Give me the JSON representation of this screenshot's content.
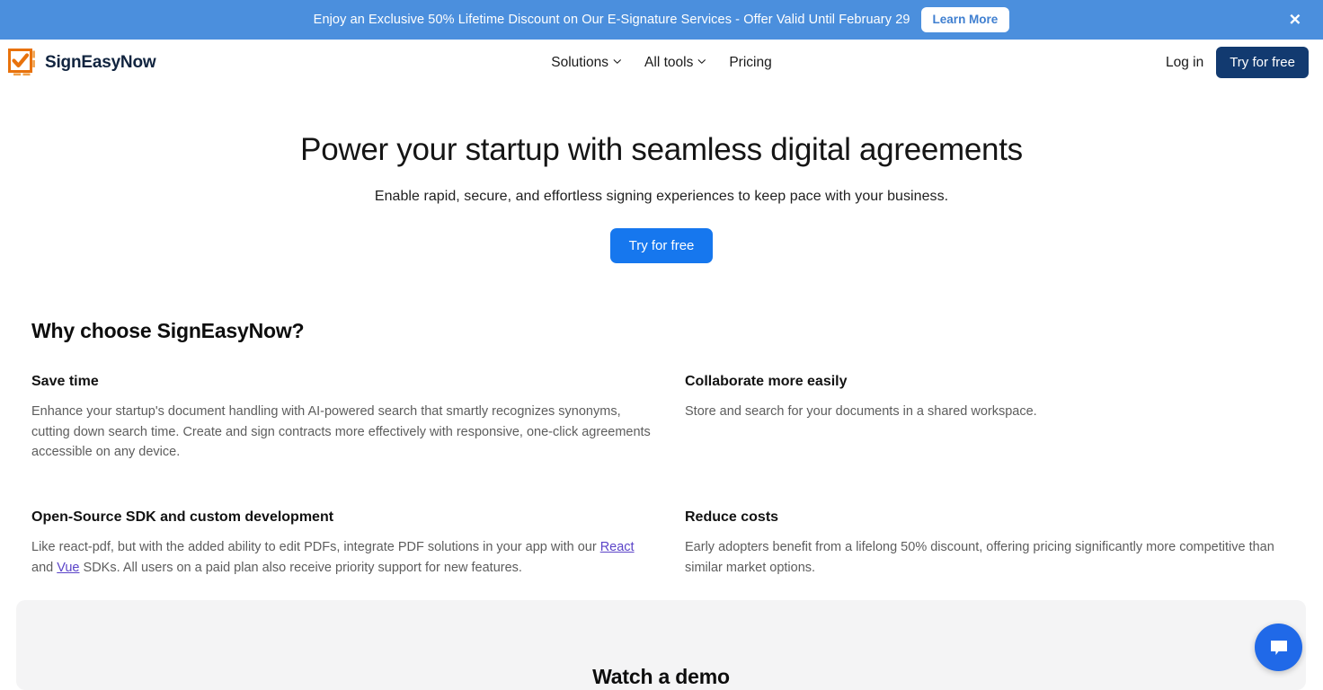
{
  "promo": {
    "text": "Enjoy an Exclusive 50% Lifetime Discount on Our E-Signature Services - Offer Valid Until February 29",
    "learn_more_label": "Learn More",
    "close_label": "✕",
    "background_color": "#4b8fdd"
  },
  "header": {
    "brand_name": "SignEasyNow",
    "logo_icon": "orange-checkbox-icon",
    "logo_color": "#e8720c",
    "nav": [
      {
        "label": "Solutions",
        "has_dropdown": true,
        "icon": "chevron-down-icon"
      },
      {
        "label": "All tools",
        "has_dropdown": true,
        "icon": "chevron-down-icon"
      },
      {
        "label": "Pricing",
        "has_dropdown": false,
        "icon": ""
      }
    ],
    "login_label": "Log in",
    "try_label": "Try for free",
    "try_button_color": "#123a70"
  },
  "hero": {
    "title": "Power your startup with seamless digital agreements",
    "subtitle": "Enable rapid, secure, and effortless signing experiences to keep pace with your business.",
    "cta_label": "Try for free",
    "cta_color": "#1677ee"
  },
  "why": {
    "section_title": "Why choose SignEasyNow?",
    "features": [
      {
        "title": "Save time",
        "body": "Enhance your startup's document handling with AI-powered search that smartly recognizes synonyms, cutting down search time. Create and sign contracts more effectively with responsive, one-click agreements accessible on any device."
      },
      {
        "title": "Collaborate more easily",
        "body": "Store and search for your documents in a shared workspace."
      },
      {
        "title": "Open-Source SDK and custom development",
        "body_part1": "Like react-pdf, but with the added ability to edit PDFs, integrate PDF solutions in your app with our ",
        "link1": "React",
        "body_part2": " and ",
        "link2": "Vue",
        "body_part3": " SDKs. All users on a paid plan also receive priority support for new features.",
        "link_color": "#5b44c8"
      },
      {
        "title": "Reduce costs",
        "body": "Early adopters benefit from a lifelong 50% discount, offering pricing significantly more competitive than similar market options."
      }
    ]
  },
  "demo": {
    "title": "Watch a demo",
    "background_color": "#f4f4f5"
  },
  "chat": {
    "icon": "chat-bubble-icon",
    "color": "#2069e8"
  }
}
